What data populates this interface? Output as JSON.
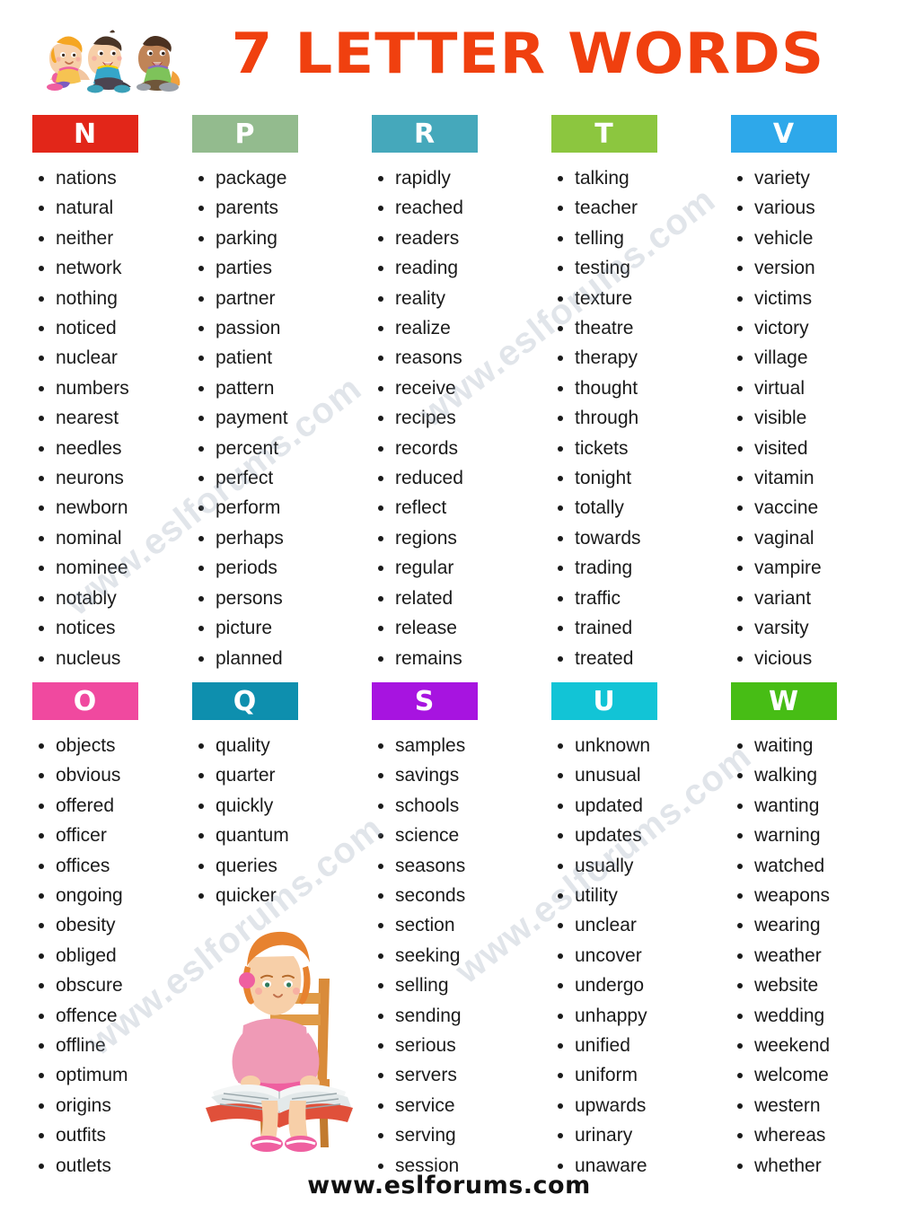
{
  "header": {
    "title": "7 LETTER WORDS",
    "title_color": "#f0400f",
    "illustration": "three-children-sitting-icon"
  },
  "footer": {
    "site": "www.eslforums.com"
  },
  "watermark": {
    "text": "www.eslforums.com"
  },
  "illustration_girl": "girl-reading-book-icon",
  "sections": [
    {
      "row": 1,
      "columns": [
        {
          "letter": "N",
          "color": "#e22619",
          "words": [
            "nations",
            "natural",
            "neither",
            "network",
            "nothing",
            "noticed",
            "nuclear",
            "numbers",
            "nearest",
            "needles",
            "neurons",
            "newborn",
            "nominal",
            "nominee",
            "notably",
            "notices",
            "nucleus"
          ]
        },
        {
          "letter": "P",
          "color": "#93bb8e",
          "words": [
            "package",
            "parents",
            "parking",
            "parties",
            "partner",
            "passion",
            "patient",
            "pattern",
            "payment",
            "percent",
            "perfect",
            "perform",
            "perhaps",
            "periods",
            "persons",
            "picture",
            "planned"
          ]
        },
        {
          "letter": "R",
          "color": "#45a8bb",
          "words": [
            "rapidly",
            "reached",
            "readers",
            "reading",
            "reality",
            "realize",
            "reasons",
            "receive",
            "recipes",
            "records",
            "reduced",
            "reflect",
            "regions",
            "regular",
            "related",
            "release",
            "remains"
          ]
        },
        {
          "letter": "T",
          "color": "#8cc63f",
          "words": [
            "talking",
            "teacher",
            "telling",
            "testing",
            "texture",
            "theatre",
            "therapy",
            "thought",
            "through",
            "tickets",
            "tonight",
            "totally",
            "towards",
            "trading",
            "traffic",
            "trained",
            "treated"
          ]
        },
        {
          "letter": "V",
          "color": "#2ea8ea",
          "words": [
            "variety",
            "various",
            "vehicle",
            "version",
            "victims",
            "victory",
            "village",
            "virtual",
            "visible",
            "visited",
            "vitamin",
            "vaccine",
            "vaginal",
            "vampire",
            "variant",
            "varsity",
            "vicious"
          ]
        }
      ]
    },
    {
      "row": 2,
      "columns": [
        {
          "letter": "O",
          "color": "#f0499f",
          "words": [
            "objects",
            "obvious",
            "offered",
            "officer",
            "offices",
            "ongoing",
            "obesity",
            "obliged",
            "obscure",
            "offence",
            "offline",
            "optimum",
            "origins",
            "outfits",
            "outlets"
          ]
        },
        {
          "letter": "Q",
          "color": "#0e8fae",
          "words": [
            "quality",
            "quarter",
            "quickly",
            "quantum",
            "queries",
            "quicker"
          ]
        },
        {
          "letter": "S",
          "color": "#a714e0",
          "words": [
            "samples",
            "savings",
            "schools",
            "science",
            "seasons",
            "seconds",
            "section",
            "seeking",
            "selling",
            "sending",
            "serious",
            "servers",
            "service",
            "serving",
            "session"
          ]
        },
        {
          "letter": "U",
          "color": "#12c4d6",
          "words": [
            "unknown",
            "unusual",
            "updated",
            "updates",
            "usually",
            "utility",
            "unclear",
            "uncover",
            "undergo",
            "unhappy",
            "unified",
            "uniform",
            "upwards",
            "urinary",
            "unaware"
          ]
        },
        {
          "letter": "W",
          "color": "#47bd15",
          "words": [
            "waiting",
            "walking",
            "wanting",
            "warning",
            "watched",
            "weapons",
            "wearing",
            "weather",
            "website",
            "wedding",
            "weekend",
            "welcome",
            "western",
            "whereas",
            "whether"
          ]
        }
      ]
    }
  ]
}
